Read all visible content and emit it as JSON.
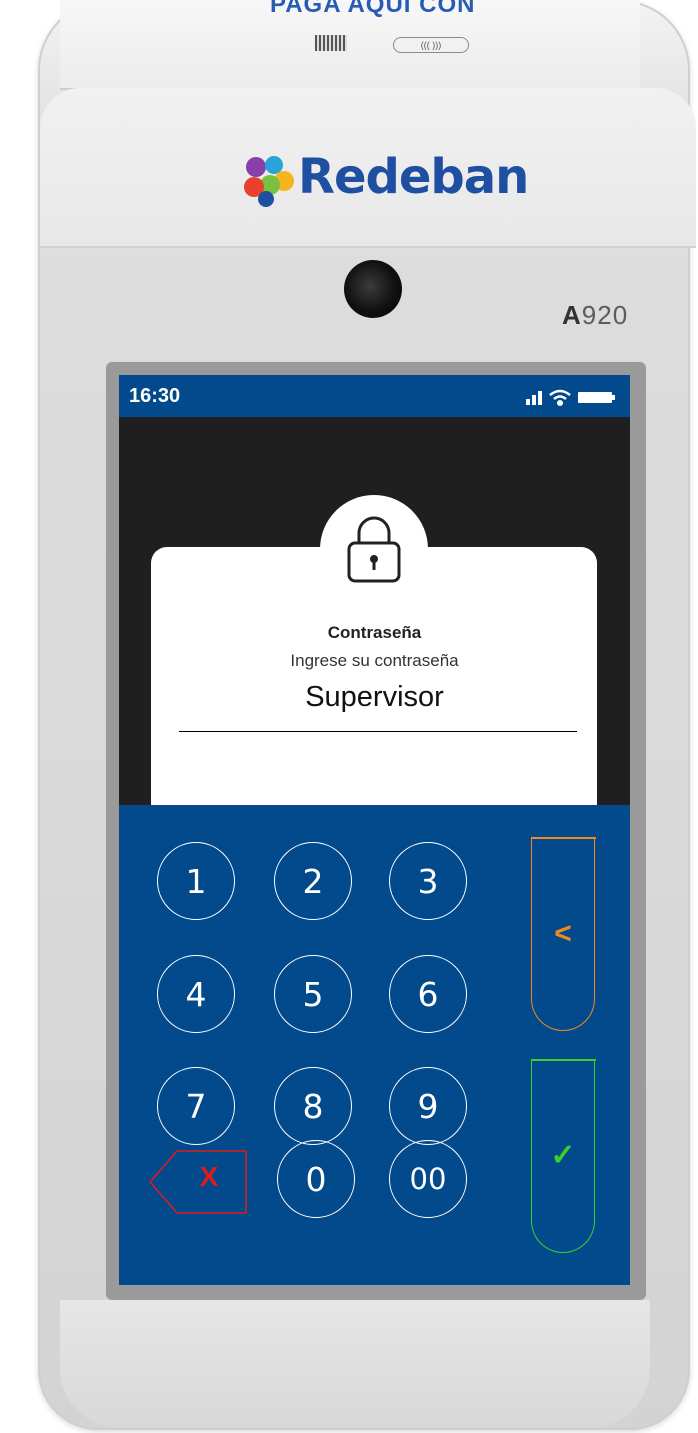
{
  "device": {
    "header_text": "PAGA AQUÍ CON",
    "nfc_label": "((( ))) ",
    "brand": "Redeban",
    "brand_mark": "·",
    "model_bold": "A",
    "model_rest": "920"
  },
  "status_bar": {
    "time": "16:30",
    "icons": [
      "signal-icon",
      "wifi-icon",
      "battery-icon"
    ]
  },
  "dialog": {
    "icon": "lock-icon",
    "title": "Contraseña",
    "subtitle": "Ingrese su contraseña",
    "value": "Supervisor"
  },
  "keypad": {
    "keys": [
      "1",
      "2",
      "3",
      "4",
      "5",
      "6",
      "7",
      "8",
      "9",
      "0",
      "00"
    ],
    "delete_label": "X",
    "back_label": "<",
    "confirm_label": "✓"
  },
  "colors": {
    "primary_blue": "#024a8c",
    "back_orange": "#f08a1e",
    "confirm_green": "#39d12a",
    "delete_red": "#e01b1b"
  }
}
